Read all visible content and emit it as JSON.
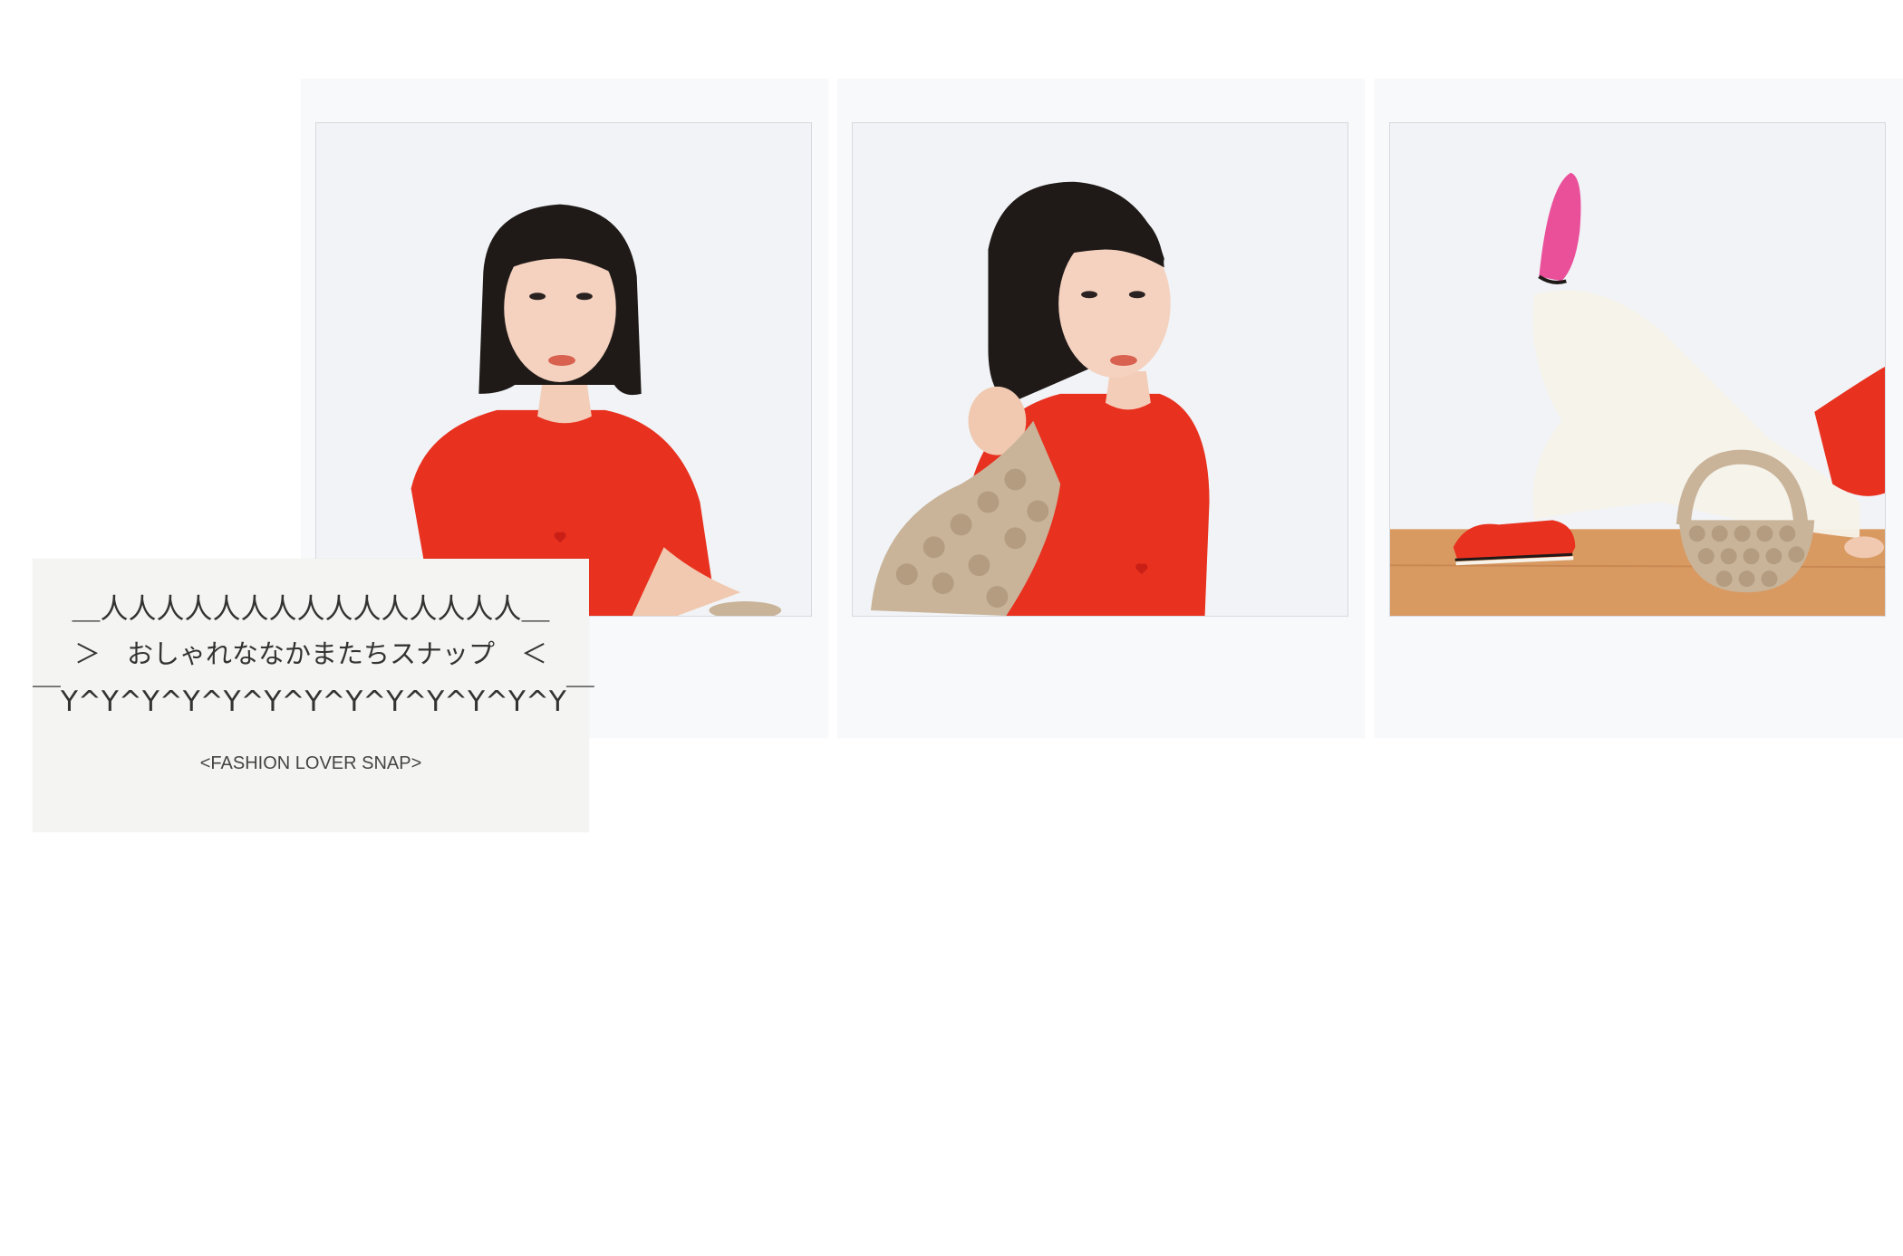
{
  "title_card": {
    "deco_top": "＿人人人人人人人人人人人人人人人＿",
    "title_jp": "＞　おしゃれななかまたちスナップ　＜",
    "deco_bottom": "￣Y^Y^Y^Y^Y^Y^Y^Y^Y^Y^Y^Y^Y￣",
    "title_en": "<FASHION LOVER SNAP>"
  },
  "photos": [
    {
      "subject": "portrait-front",
      "description_icon": "person-photo"
    },
    {
      "subject": "portrait-side-with-bag",
      "description_icon": "person-photo"
    },
    {
      "subject": "shoes-and-bag",
      "description_icon": "product-photo"
    }
  ],
  "colors": {
    "shirt_red": "#e8311f",
    "knit_bag": "#c9b49a",
    "background_wall": "#f1f3f6",
    "floor_wood": "#d99a62",
    "pink_shoe": "#ea4f9a"
  }
}
